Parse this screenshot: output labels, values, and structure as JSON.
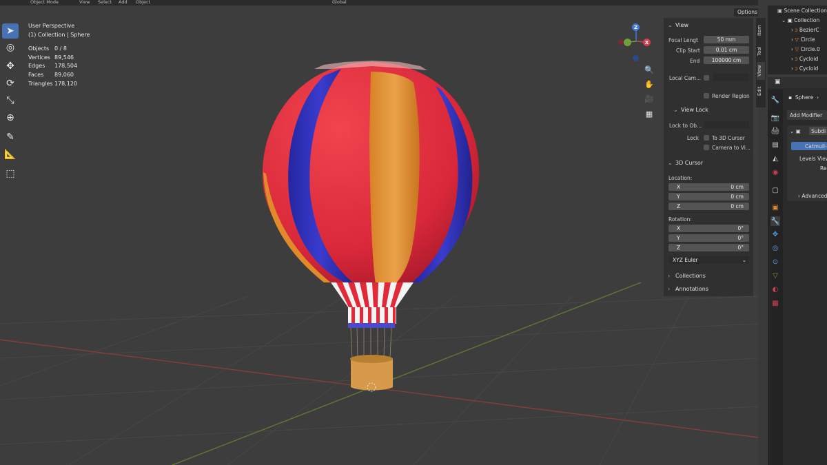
{
  "header": {
    "mode": "Object Mode",
    "menus": [
      "View",
      "Select",
      "Add",
      "Object"
    ],
    "transform_orientation": "Global",
    "options_label": "Options"
  },
  "viewport": {
    "perspective": "User Perspective",
    "collection_info": "(1) Collection | Sphere",
    "stats": [
      {
        "k": "Objects",
        "v": "0 / 8"
      },
      {
        "k": "Vertices",
        "v": "89,546"
      },
      {
        "k": "Edges",
        "v": "178,504"
      },
      {
        "k": "Faces",
        "v": "89,060"
      },
      {
        "k": "Triangles",
        "v": "178,120"
      }
    ],
    "gizmo": {
      "z": "Z",
      "y": "Y",
      "x": "X"
    }
  },
  "npanel": {
    "tabs": [
      "Item",
      "Tool",
      "View",
      "Edit"
    ],
    "view_section": "View",
    "focal_length_label": "Focal Lengt",
    "focal_length": "50 mm",
    "clip_start_label": "Clip Start",
    "clip_start": "0.01 cm",
    "clip_end_label": "End",
    "clip_end": "100000 cm",
    "local_camera_label": "Local Cam...",
    "render_region": "Render Region",
    "view_lock": "View Lock",
    "lock_to_object_label": "Lock to Ob...",
    "lock_label": "Lock",
    "to_3d_cursor": "To 3D Cursor",
    "camera_to_view": "Camera to Vi...",
    "cursor_section": "3D Cursor",
    "location_label": "Location:",
    "location": [
      {
        "axis": "X",
        "value": "0 cm"
      },
      {
        "axis": "Y",
        "value": "0 cm"
      },
      {
        "axis": "Z",
        "value": "0 cm"
      }
    ],
    "rotation_label": "Rotation:",
    "rotation": [
      {
        "axis": "X",
        "value": "0°"
      },
      {
        "axis": "Y",
        "value": "0°"
      },
      {
        "axis": "Z",
        "value": "0°"
      }
    ],
    "rotation_mode": "XYZ Euler",
    "collections": "Collections",
    "annotations": "Annotations"
  },
  "outliner": {
    "scene_collection": "Scene Collection",
    "collection": "Collection",
    "items": [
      "BezierC",
      "Circle",
      "Circle.0",
      "Cycloid",
      "Cycloid"
    ]
  },
  "properties": {
    "object_name": "Sphere",
    "add_modifier": "Add Modifier",
    "modifier_name": "Subdi",
    "catmull": "Catmull-",
    "levels_viewport": "Levels View",
    "render": "Re",
    "advanced": "Advanced"
  },
  "colors": {
    "balloon_red": "#e1323f",
    "balloon_blue": "#2d2fb8",
    "balloon_orange": "#e08a2a",
    "basket": "#d69a4a",
    "accent": "#4772b3"
  }
}
